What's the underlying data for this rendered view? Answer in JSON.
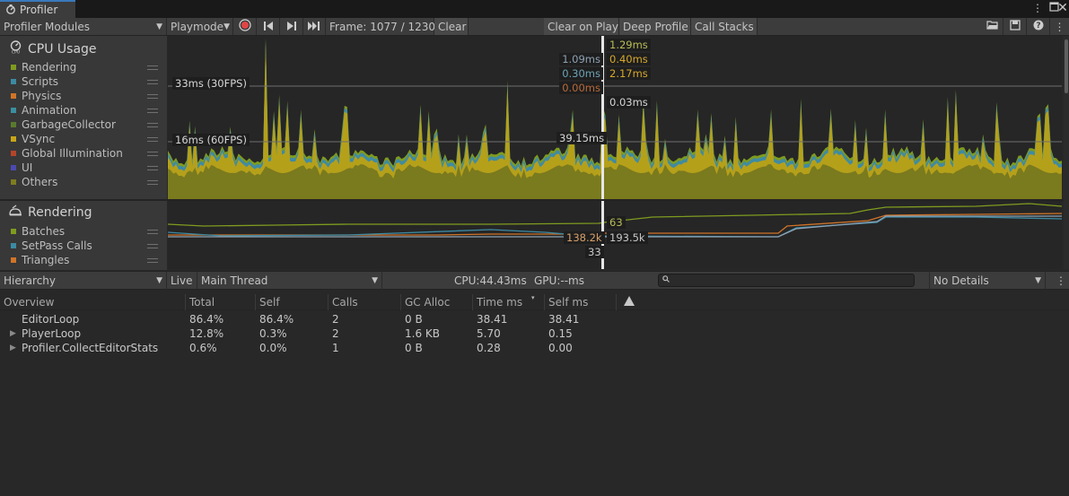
{
  "window": {
    "tab_title": "Profiler"
  },
  "toolbar": {
    "modules_dropdown": "Profiler Modules",
    "playmode": "Playmode",
    "frame": "Frame: 1077 / 1230",
    "clear": "Clear",
    "clear_on_play": "Clear on Play",
    "deep_profile": "Deep Profile",
    "call_stacks": "Call Stacks"
  },
  "cpu_module": {
    "title": "CPU Usage",
    "legend": [
      {
        "label": "Rendering",
        "color": "#7f9b1f"
      },
      {
        "label": "Scripts",
        "color": "#3c8aa3"
      },
      {
        "label": "Physics",
        "color": "#d07428"
      },
      {
        "label": "Animation",
        "color": "#3a8fa0"
      },
      {
        "label": "GarbageCollector",
        "color": "#5a7a2e"
      },
      {
        "label": "VSync",
        "color": "#c8a518"
      },
      {
        "label": "Global Illumination",
        "color": "#b5442a"
      },
      {
        "label": "UI",
        "color": "#4a4ab0"
      },
      {
        "label": "Others",
        "color": "#7d7d20"
      }
    ],
    "ref_lines": [
      "33ms (30FPS)",
      "16ms (60FPS)"
    ],
    "readouts_left": [
      "1.09ms",
      "0.30ms",
      "0.00ms",
      "39.15ms"
    ],
    "readouts_right": [
      "1.29ms",
      "0.40ms",
      "2.17ms",
      "0.03ms"
    ],
    "readout_left_colors": [
      "#8fa2b4",
      "#6da3b5",
      "#b86a3a",
      "#d6d6d6"
    ],
    "readout_right_colors": [
      "#b8bd55",
      "#d6a82c",
      "#d6a82c",
      "#d6d6d6"
    ]
  },
  "rendering_module": {
    "title": "Rendering",
    "legend": [
      {
        "label": "Batches",
        "color": "#7f9b1f"
      },
      {
        "label": "SetPass Calls",
        "color": "#3c8aa3"
      },
      {
        "label": "Triangles",
        "color": "#d07428"
      }
    ],
    "readouts": {
      "batches": "63",
      "triangles": "138.2k",
      "vertices": "193.5k",
      "setpass": "33"
    }
  },
  "details_bar": {
    "view": "Hierarchy",
    "live": "Live",
    "thread": "Main Thread",
    "cpu": "CPU:44.43ms",
    "gpu": "GPU:--ms",
    "search_placeholder": "",
    "details": "No Details"
  },
  "table": {
    "headers": [
      "Overview",
      "Total",
      "Self",
      "Calls",
      "GC Alloc",
      "Time ms",
      "Self ms"
    ],
    "rows": [
      {
        "name": "EditorLoop",
        "expandable": false,
        "total": "86.4%",
        "self": "86.4%",
        "calls": "2",
        "gc": "0 B",
        "time": "38.41",
        "selfms": "38.41"
      },
      {
        "name": "PlayerLoop",
        "expandable": true,
        "total": "12.8%",
        "self": "0.3%",
        "calls": "2",
        "gc": "1.6 KB",
        "time": "5.70",
        "selfms": "0.15"
      },
      {
        "name": "Profiler.CollectEditorStats",
        "expandable": true,
        "total": "0.6%",
        "self": "0.0%",
        "calls": "1",
        "gc": "0 B",
        "time": "0.28",
        "selfms": "0.00"
      }
    ]
  }
}
